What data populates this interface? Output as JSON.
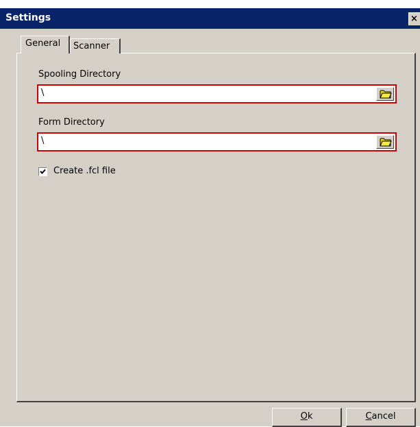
{
  "window": {
    "title": "Settings",
    "close_label": "×"
  },
  "tabs": [
    {
      "label": "General",
      "active": true
    },
    {
      "label": "Scanner",
      "active": false
    }
  ],
  "spooling": {
    "label": "Spooling Directory",
    "value": "\\",
    "icon": "folder-icon"
  },
  "form": {
    "label": "Form Directory",
    "value": "\\",
    "icon": "folder-icon"
  },
  "create_fcl": {
    "label": "Create .fcl file",
    "checked": true
  },
  "buttons": {
    "ok": {
      "mnemonic": "O",
      "rest": "k"
    },
    "cancel": {
      "mnemonic": "C",
      "rest": "ancel"
    }
  },
  "colors": {
    "title_bar": "#0a246a",
    "field_highlight": "#d00000",
    "dialog_bg": "#d4d0c8",
    "folder_icon": "#e6d600"
  }
}
